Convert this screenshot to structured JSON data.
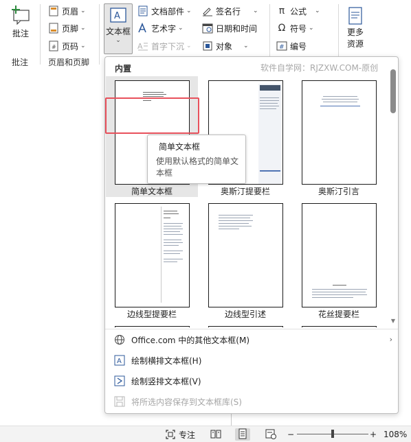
{
  "ribbon": {
    "comment_group": {
      "button_label": "批注",
      "group_label": "批注"
    },
    "header_footer_group": {
      "items": [
        {
          "label": "页眉"
        },
        {
          "label": "页脚"
        },
        {
          "label": "页码"
        }
      ],
      "group_label": "页眉和页脚"
    },
    "text_group": {
      "textbox_label": "文本框",
      "items": [
        {
          "label": "文档部件"
        },
        {
          "label": "艺术字"
        },
        {
          "label": "首字下沉"
        },
        {
          "label": "签名行"
        },
        {
          "label": "日期和时间"
        },
        {
          "label": "对象"
        }
      ]
    },
    "symbols_group": {
      "items": [
        {
          "label": "公式"
        },
        {
          "label": "符号"
        },
        {
          "label": "编号"
        }
      ]
    },
    "more_resources": {
      "label_line1": "更多",
      "label_line2": "资源"
    }
  },
  "dropdown": {
    "section_title": "内置",
    "watermark": "软件自学网：RJZXW.COM-原创",
    "gallery_items": [
      {
        "label": "简单文本框"
      },
      {
        "label": "奥斯汀提要栏"
      },
      {
        "label": "奥斯汀引言"
      },
      {
        "label": "边线型提要栏"
      },
      {
        "label": "边线型引述"
      },
      {
        "label": "花丝提要栏"
      }
    ],
    "menu_items": [
      {
        "label": "Office.com 中的其他文本框(M)"
      },
      {
        "label": "绘制横排文本框(H)"
      },
      {
        "label": "绘制竖排文本框(V)"
      },
      {
        "label": "将所选内容保存到文本框库(S)"
      }
    ]
  },
  "tooltip": {
    "title": "简单文本框",
    "description": "使用默认格式的简单文本框"
  },
  "statusbar": {
    "focus_label": "专注",
    "zoom_level": "108%",
    "zoom_minus": "−",
    "zoom_plus": "+"
  },
  "colors": {
    "accent_blue": "#2b579a",
    "highlight_red": "#e8505b",
    "selection_gray": "#e6e6e6"
  }
}
